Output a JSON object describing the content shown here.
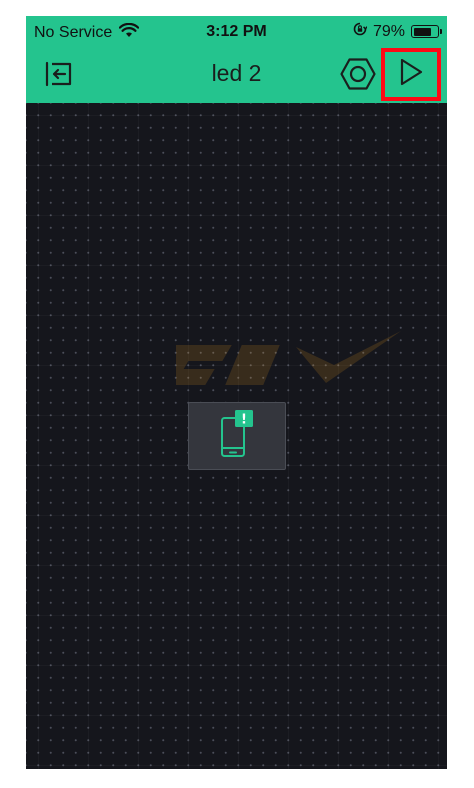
{
  "status_bar": {
    "carrier": "No Service",
    "time": "3:12 PM",
    "battery_percent": "79%",
    "battery_level": 0.79,
    "icons": [
      "wifi-icon",
      "rotation-lock-icon",
      "battery-icon"
    ]
  },
  "toolbar": {
    "title": "led 2",
    "back_icon": "exit-project-icon",
    "settings_icon": "hexagon-settings-icon",
    "play_icon": "play-icon"
  },
  "canvas": {
    "device_status_icon": "phone-warning-icon",
    "device_badge": "!"
  },
  "colors": {
    "accent": "#24c48e",
    "canvas_bg": "#15161c",
    "highlight": "#ff0a16",
    "device_icon": "#24c48e",
    "card_bg": "#34363d"
  }
}
